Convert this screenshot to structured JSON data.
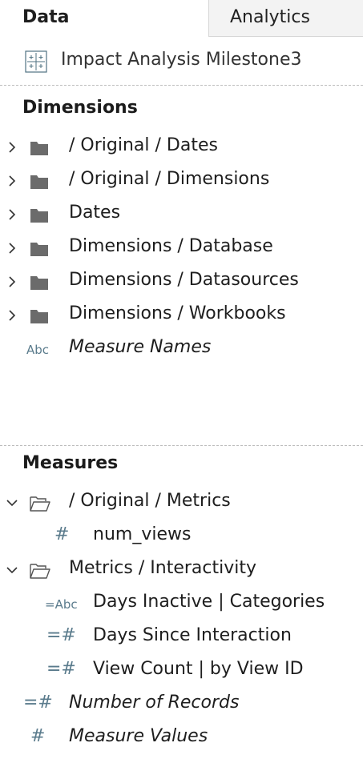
{
  "tabs": {
    "data": "Data",
    "analytics": "Analytics"
  },
  "datasource": {
    "name": "Impact Analysis Milestone3",
    "icon": "datasource-grid-icon"
  },
  "dimensions": {
    "title": "Dimensions",
    "items": [
      {
        "label": "/ Original / Dates",
        "icon": "folder-icon"
      },
      {
        "label": "/ Original / Dimensions",
        "icon": "folder-icon"
      },
      {
        "label": "Dates",
        "icon": "folder-icon"
      },
      {
        "label": "Dimensions / Database",
        "icon": "folder-icon"
      },
      {
        "label": "Dimensions / Datasources",
        "icon": "folder-icon"
      },
      {
        "label": "Dimensions / Workbooks",
        "icon": "folder-icon"
      }
    ],
    "measure_names": {
      "type": "Abc",
      "label": "Measure Names"
    }
  },
  "measures": {
    "title": "Measures",
    "folder1": {
      "label": "/ Original / Metrics",
      "icon": "open-folder-icon"
    },
    "num_views": {
      "type": "#",
      "label": "num_views"
    },
    "folder2": {
      "label": "Metrics / Interactivity",
      "icon": "open-folder-icon"
    },
    "days_inactive": {
      "type": "=Abc",
      "label": "Days Inactive | Categories"
    },
    "days_since": {
      "type": "=#",
      "label": "Days Since Interaction"
    },
    "view_count": {
      "type": "=#",
      "label": "View Count | by View ID"
    },
    "num_records": {
      "type": "=#",
      "label": "Number of Records"
    },
    "measure_values": {
      "type": "#",
      "label": "Measure Values"
    }
  },
  "colors": {
    "type_icon": "#5a7b8c",
    "folder": "#6b6b6b",
    "text": "#1e1e1e"
  }
}
